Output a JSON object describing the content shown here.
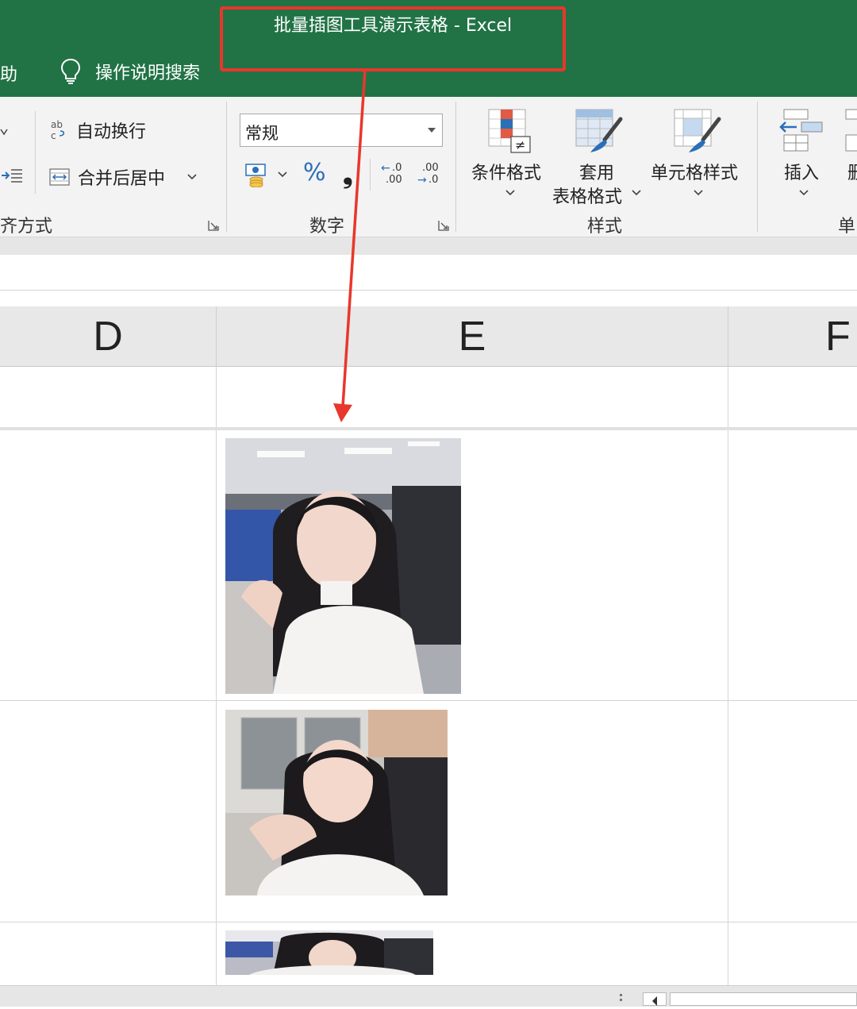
{
  "window": {
    "title": "批量插图工具演示表格  -  Excel",
    "help_tab": "助",
    "tell_me": "操作说明搜索"
  },
  "ribbon": {
    "alignment": {
      "wrap_text": "自动换行",
      "merge_center": "合并后居中",
      "group_label": "齐方式"
    },
    "number": {
      "format_value": "常规",
      "percent": "%",
      "comma": "❟",
      "inc_decimal": [
        ".0",
        ".00"
      ],
      "dec_decimal": [
        ".00",
        ".0"
      ],
      "group_label": "数字"
    },
    "styles": {
      "conditional": "条件格式",
      "table_format_1": "套用",
      "table_format_2": "表格格式",
      "cell_styles": "单元格样式",
      "group_label": "样式"
    },
    "cells": {
      "insert": "插入",
      "delete_partial": "删",
      "group_label": "单"
    }
  },
  "columns": [
    "D",
    "E",
    "F"
  ],
  "colors": {
    "excel_green": "#217346",
    "highlight_red": "#e8372c"
  }
}
